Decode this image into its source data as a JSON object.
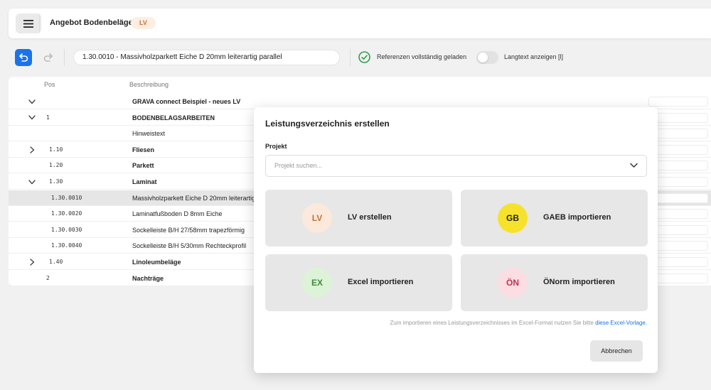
{
  "header": {
    "title": "Angebot Bodenbeläge",
    "badge": "LV"
  },
  "toolbar": {
    "path": "1.30.0010 - Massivholzparkett Eiche D 20mm leiterartig parallel",
    "references_status": "Referenzen vollständig geladen",
    "langtext_label": "Langtext anzeigen [l]"
  },
  "table": {
    "columns": [
      "Pos",
      "Beschreibung"
    ],
    "rows": [
      {
        "expand": "down",
        "pos": "",
        "desc": "GRAVA connect Beispiel - neues LV",
        "bold": true
      },
      {
        "expand": "down",
        "pos": "1",
        "desc": "BODENBELAGSARBEITEN",
        "bold": true
      },
      {
        "expand": "",
        "pos": "",
        "desc": "Hinweistext",
        "bold": false
      },
      {
        "expand": "right",
        "pos": "1.10",
        "desc": "Fliesen",
        "bold": true
      },
      {
        "expand": "",
        "pos": "1.20",
        "desc": "Parkett",
        "bold": true
      },
      {
        "expand": "down",
        "pos": "1.30",
        "desc": "Laminat",
        "bold": true
      },
      {
        "expand": "",
        "pos": "1.30.0010",
        "desc": "Massivholzparkett Eiche D 20mm leiterartig",
        "bold": false,
        "selected": true
      },
      {
        "expand": "",
        "pos": "1.30.0020",
        "desc": "Laminatfußboden D 8mm Eiche",
        "bold": false
      },
      {
        "expand": "",
        "pos": "1.30.0030",
        "desc": "Sockelleiste B/H 27/58mm trapezförmig",
        "bold": false
      },
      {
        "expand": "",
        "pos": "1.30.0040",
        "desc": "Sockelleiste B/H 5/30mm Rechteckprofil",
        "bold": false
      },
      {
        "expand": "right",
        "pos": "1.40",
        "desc": "Linoleumbeläge",
        "bold": true
      },
      {
        "expand": "",
        "pos": "2",
        "desc": "Nachträge",
        "bold": true
      }
    ]
  },
  "modal": {
    "title": "Leistungsverzeichnis erstellen",
    "project_label": "Projekt",
    "project_placeholder": "Projekt suchen...",
    "cards": [
      {
        "abbr": "LV",
        "label": "LV erstellen",
        "bg": "#fbe9dc",
        "fg": "#c8713b"
      },
      {
        "abbr": "GB",
        "label": "GAEB importieren",
        "bg": "#f6e22c",
        "fg": "#222222"
      },
      {
        "abbr": "EX",
        "label": "Excel importieren",
        "bg": "#dcf3d8",
        "fg": "#3f8a3a"
      },
      {
        "abbr": "ÖN",
        "label": "ÖNorm importieren",
        "bg": "#fbdde3",
        "fg": "#c2334e"
      }
    ],
    "hint_text": "Zum importieren eines Leistungsverzeichnisses im Excel-Format nutzen Sie bitte",
    "hint_link": "diese Excel-Vorlage.",
    "cancel_label": "Abbrechen"
  },
  "colors": {
    "accent": "#1a73e8",
    "success": "#2e9e4f"
  }
}
